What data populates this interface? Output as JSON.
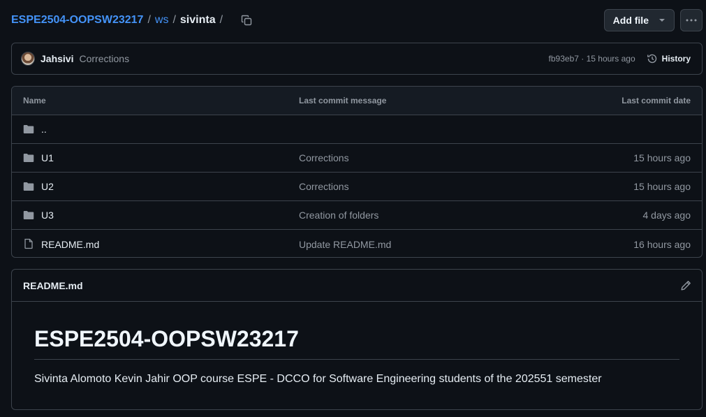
{
  "breadcrumb": {
    "repo": "ESPE2504-OOPSW23217",
    "sep1": "/",
    "folder": "ws",
    "sep2": "/",
    "current": "sivinta",
    "sep3": "/"
  },
  "toolbar": {
    "add_file_label": "Add file"
  },
  "commit": {
    "author": "Jahsivi",
    "message": "Corrections",
    "meta": "fb93eb7 · 15 hours ago",
    "history_label": "History"
  },
  "table": {
    "headers": {
      "name": "Name",
      "message": "Last commit message",
      "date": "Last commit date"
    },
    "rows": [
      {
        "name": "..",
        "message": "",
        "date": "",
        "type": "folder-icon"
      },
      {
        "name": "U1",
        "message": "Corrections",
        "date": "15 hours ago",
        "type": "folder-icon"
      },
      {
        "name": "U2",
        "message": "Corrections",
        "date": "15 hours ago",
        "type": "folder-icon"
      },
      {
        "name": "U3",
        "message": "Creation of folders",
        "date": "4 days ago",
        "type": "folder-icon"
      },
      {
        "name": "README.md",
        "message": "Update README.md",
        "date": "16 hours ago",
        "type": "file-icon"
      }
    ]
  },
  "readme": {
    "title": "README.md",
    "heading": "ESPE2504-OOPSW23217",
    "paragraph": "Sivinta Alomoto Kevin Jahir OOP course ESPE - DCCO for Software Engineering students of the 202551 semester"
  },
  "colors": {
    "background": "#0d1117",
    "link": "#4493f8",
    "border": "#3d444d",
    "muted": "#9198a1"
  }
}
